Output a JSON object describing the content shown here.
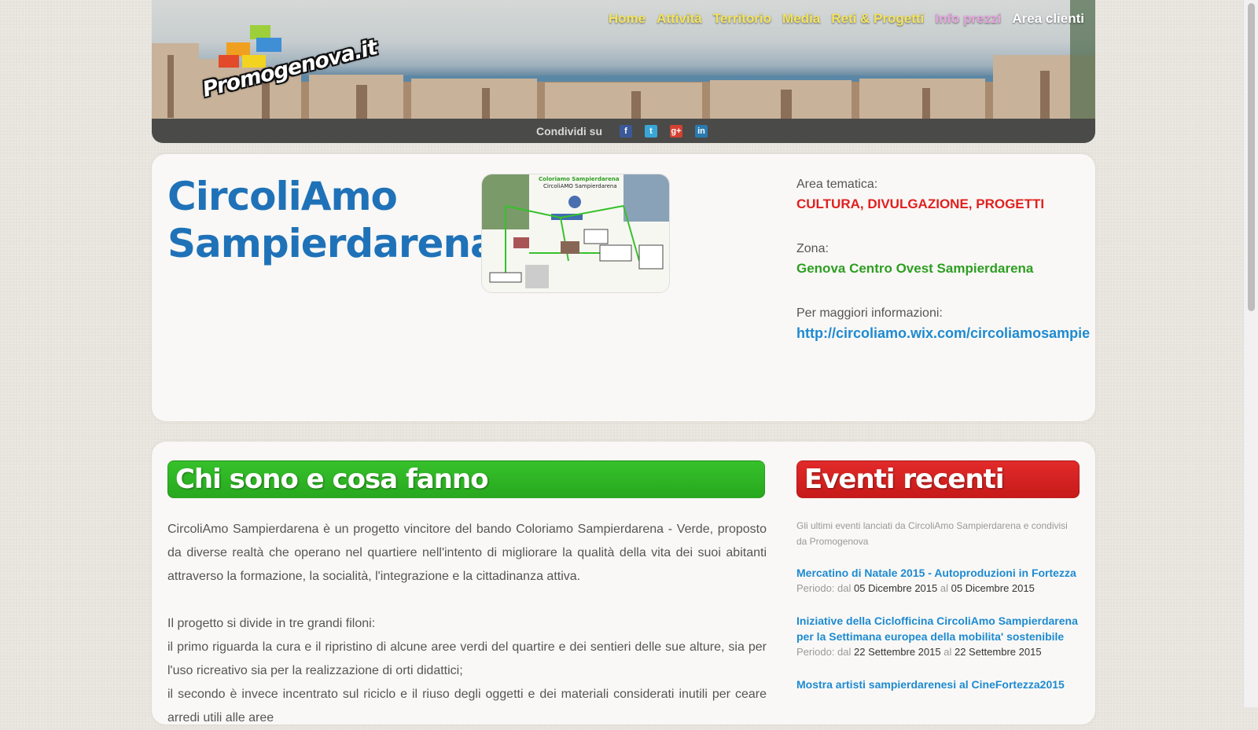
{
  "header": {
    "logo_text": "Promogenova.it",
    "nav": [
      {
        "label": "Home",
        "color": "#f3e45a"
      },
      {
        "label": "Attività",
        "color": "#f3e45a"
      },
      {
        "label": "Territorio",
        "color": "#f3e45a"
      },
      {
        "label": "Media",
        "color": "#f3e45a"
      },
      {
        "label": "Reti & Progetti",
        "color": "#f3e45a"
      },
      {
        "label": "Info prezzi",
        "color": "#e8a6e0"
      },
      {
        "label": "Area clienti",
        "color": "#ffffff"
      }
    ],
    "share_label": "Condividi su",
    "share_icons": [
      {
        "name": "facebook-icon",
        "glyph": "f",
        "color": "#3b5998"
      },
      {
        "name": "twitter-icon",
        "glyph": "t",
        "color": "#38a6d6"
      },
      {
        "name": "google-plus-icon",
        "glyph": "g+",
        "color": "#d44132"
      },
      {
        "name": "linkedin-icon",
        "glyph": "in",
        "color": "#2a7ab0"
      }
    ]
  },
  "org": {
    "title": "CircoliAmo Sampierdarena",
    "image_caption_1": "Coloriamo Sampierdarena",
    "image_caption_2": "CircoliAMO Sampierdarena"
  },
  "info": {
    "area_label": "Area tematica:",
    "area_value": "CULTURA, DIVULGAZIONE, PROGETTI",
    "area_color": "#e0201f",
    "zona_label": "Zona:",
    "zona_value": "Genova Centro Ovest Sampierdarena",
    "zona_color": "#2e9e22",
    "more_label": "Per maggiori informazioni:",
    "more_value": "http://circoliamo.wix.com/circoliamosampie",
    "more_color": "#1d8ad1"
  },
  "about": {
    "heading": "Chi sono e cosa fanno",
    "p1": "CircoliAmo Sampierdarena è un progetto vincitore del bando Coloriamo Sampierdarena - Verde, proposto da diverse realtà che operano nel quartiere nell'intento di migliorare la qualità della vita dei suoi abitanti attraverso la formazione, la socialità, l'integrazione e la cittadinanza attiva.",
    "p2": "Il progetto si divide in tre grandi filoni:",
    "p3": "il primo riguarda la cura e il ripristino di alcune aree verdi del quartire e dei sentieri delle sue alture, sia per l'uso ricreativo sia per la realizzazione di orti didattici;",
    "p4": "il secondo è invece incentrato sul riciclo e il riuso degli oggetti e dei materiali considerati inutili per ceare arredi utili alle aree"
  },
  "events": {
    "heading": "Eventi recenti",
    "intro": "Gli ultimi eventi lanciati da CircoliAmo Sampierdarena e condivisi da Promogenova",
    "items": [
      {
        "title": "Mercatino di Natale 2015 - Autoproduzioni in Fortezza",
        "period_label": "Periodo: dal",
        "from": "05 Dicembre 2015",
        "to_label": "al",
        "to": "05 Dicembre 2015"
      },
      {
        "title": "Iniziative della Ciclofficina CircoliAmo Sampierdarena per la Settimana europea della mobilita' sostenibile",
        "period_label": "Periodo: dal",
        "from": "22 Settembre 2015",
        "to_label": "al",
        "to": "22 Settembre 2015"
      },
      {
        "title": "Mostra artisti sampierdarenesi al CineFortezza2015",
        "period_label": "",
        "from": "",
        "to_label": "",
        "to": ""
      }
    ]
  }
}
